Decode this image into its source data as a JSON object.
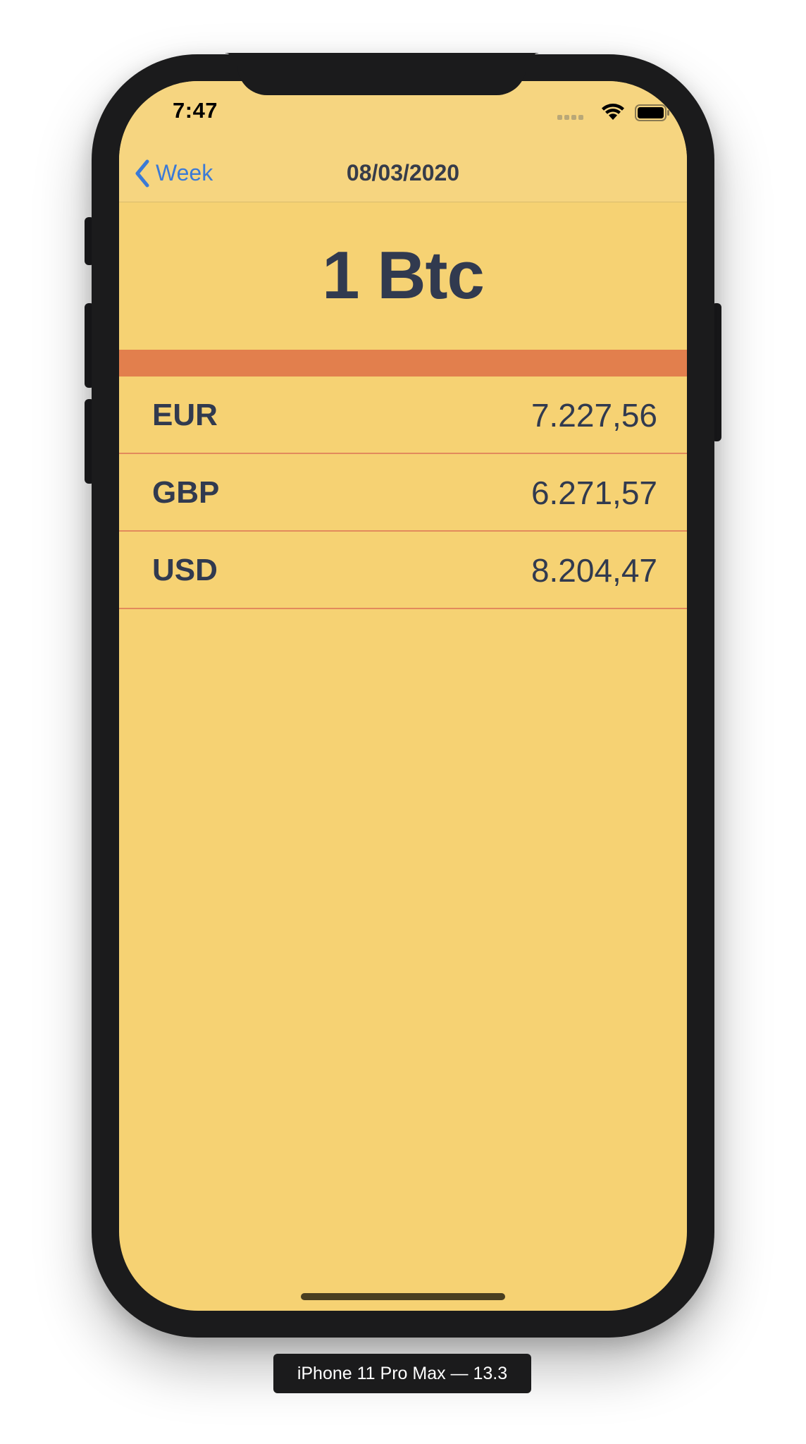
{
  "status_bar": {
    "time": "7:47",
    "icons": [
      "cellular-signal-icon",
      "wifi-icon",
      "battery-icon"
    ]
  },
  "nav": {
    "back_label": "Week",
    "title": "08/03/2020"
  },
  "header": {
    "amount": "1 Btc"
  },
  "rates": [
    {
      "code": "EUR",
      "value": "7.227,56"
    },
    {
      "code": "GBP",
      "value": "6.271,57"
    },
    {
      "code": "USD",
      "value": "8.204,47"
    }
  ],
  "device_caption": "iPhone 11 Pro Max — 13.3",
  "colors": {
    "background": "#f6d273",
    "accent": "#e27f4d",
    "text": "#313a4f",
    "link": "#3b7ad6",
    "separator": "#e28a5c"
  }
}
